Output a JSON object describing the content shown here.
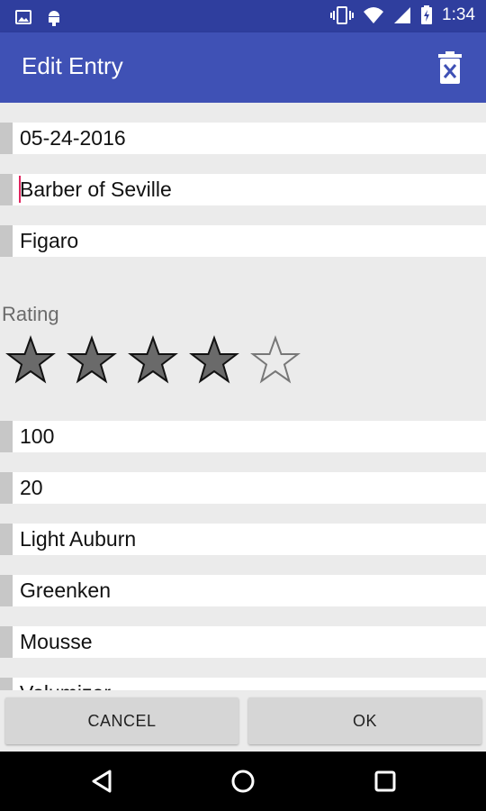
{
  "status_bar": {
    "time": "1:34"
  },
  "app_bar": {
    "title": "Edit Entry",
    "delete_icon": "delete-icon"
  },
  "fields": [
    {
      "name": "date",
      "value": "05-24-2016"
    },
    {
      "name": "title",
      "value": "Barber of Seville"
    },
    {
      "name": "name",
      "value": "Figaro"
    },
    {
      "name": "field4",
      "value": "100"
    },
    {
      "name": "field5",
      "value": "20"
    },
    {
      "name": "field6",
      "value": "Light Auburn"
    },
    {
      "name": "field7",
      "value": "Greenken"
    },
    {
      "name": "field8",
      "value": "Mousse"
    },
    {
      "name": "field9",
      "value": "Volumizer"
    }
  ],
  "rating": {
    "label": "Rating",
    "value": 4,
    "max": 5
  },
  "buttons": {
    "cancel": "CANCEL",
    "ok": "OK"
  },
  "colors": {
    "status_bar": "#2f3e9e",
    "app_bar": "#3f51b5",
    "star_fill": "#6a6a6a",
    "cursor": "#e0245e"
  }
}
